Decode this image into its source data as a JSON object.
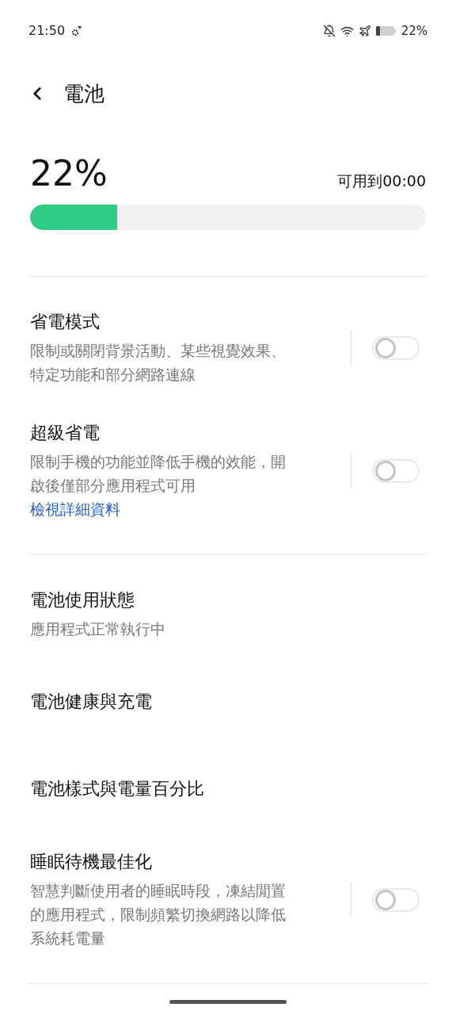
{
  "status_bar": {
    "time": "21:50",
    "battery": "22%"
  },
  "header": {
    "title": "電池"
  },
  "battery": {
    "percent": "22%",
    "estimate": "可用到00:00",
    "level": 0.22
  },
  "groups": [
    {
      "items": [
        {
          "kind": "toggle",
          "title": "省電模式",
          "description": "限制或關閉背景活動、某些視覺效果、特定功能和部分網路連線",
          "on": false
        },
        {
          "kind": "toggle",
          "title": "超級省電",
          "description": "限制手機的功能並降低手機的效能，開啟後僅部分應用程式可用",
          "link": "檢視詳細資料",
          "on": false
        }
      ]
    },
    {
      "items": [
        {
          "kind": "link",
          "title": "電池使用狀態",
          "description": "應用程式正常執行中"
        },
        {
          "kind": "link",
          "title": "電池健康與充電"
        },
        {
          "kind": "link",
          "title": "電池樣式與電量百分比"
        },
        {
          "kind": "toggle",
          "title": "睡眠待機最佳化",
          "description": "智慧判斷使用者的睡眠時段，凍結閒置的應用程式，限制頻繁切換網路以降低系統耗電量",
          "on": false
        }
      ]
    }
  ]
}
